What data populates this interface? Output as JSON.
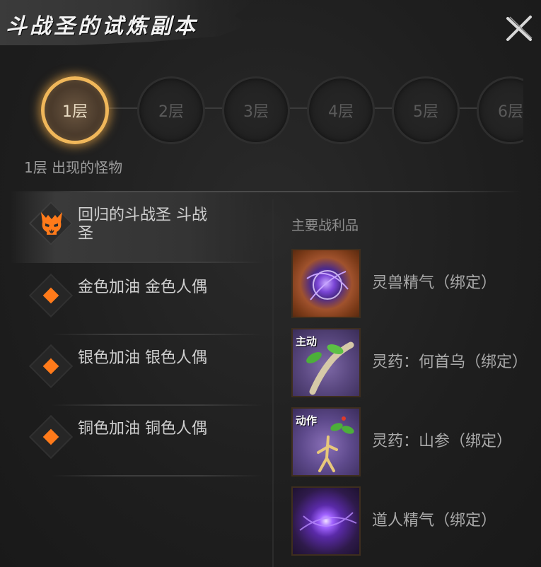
{
  "title": "斗战圣的试炼副本",
  "floors": {
    "items": [
      "1层",
      "2层",
      "3层",
      "4层",
      "5层",
      "6层"
    ],
    "active_index": 0,
    "subtitle": "1层 出现的怪物"
  },
  "monsters": [
    {
      "name": "回归的斗战圣 斗战圣",
      "icon": "demon-skull-icon",
      "selected": true
    },
    {
      "name": "金色加油 金色人偶",
      "icon": "orange-diamond-icon",
      "selected": false
    },
    {
      "name": "银色加油 银色人偶",
      "icon": "orange-diamond-icon",
      "selected": false
    },
    {
      "name": "铜色加油 铜色人偶",
      "icon": "orange-diamond-icon",
      "selected": false
    }
  ],
  "loot": {
    "title": "主要战利品",
    "items": [
      {
        "name": "灵兽精气（绑定）",
        "icon": "purple-orb-icon",
        "tag": ""
      },
      {
        "name": "灵药：何首乌（绑定）",
        "icon": "heshouwu-root-icon",
        "tag": "主动"
      },
      {
        "name": "灵药：山参（绑定）",
        "icon": "ginseng-icon",
        "tag": "动作"
      },
      {
        "name": "道人精气（绑定）",
        "icon": "purple-energy-icon",
        "tag": ""
      }
    ]
  },
  "colors": {
    "accent_orange": "#ff7a1a",
    "active_ring": "#f0b75a",
    "background": "#1f1f1f"
  }
}
